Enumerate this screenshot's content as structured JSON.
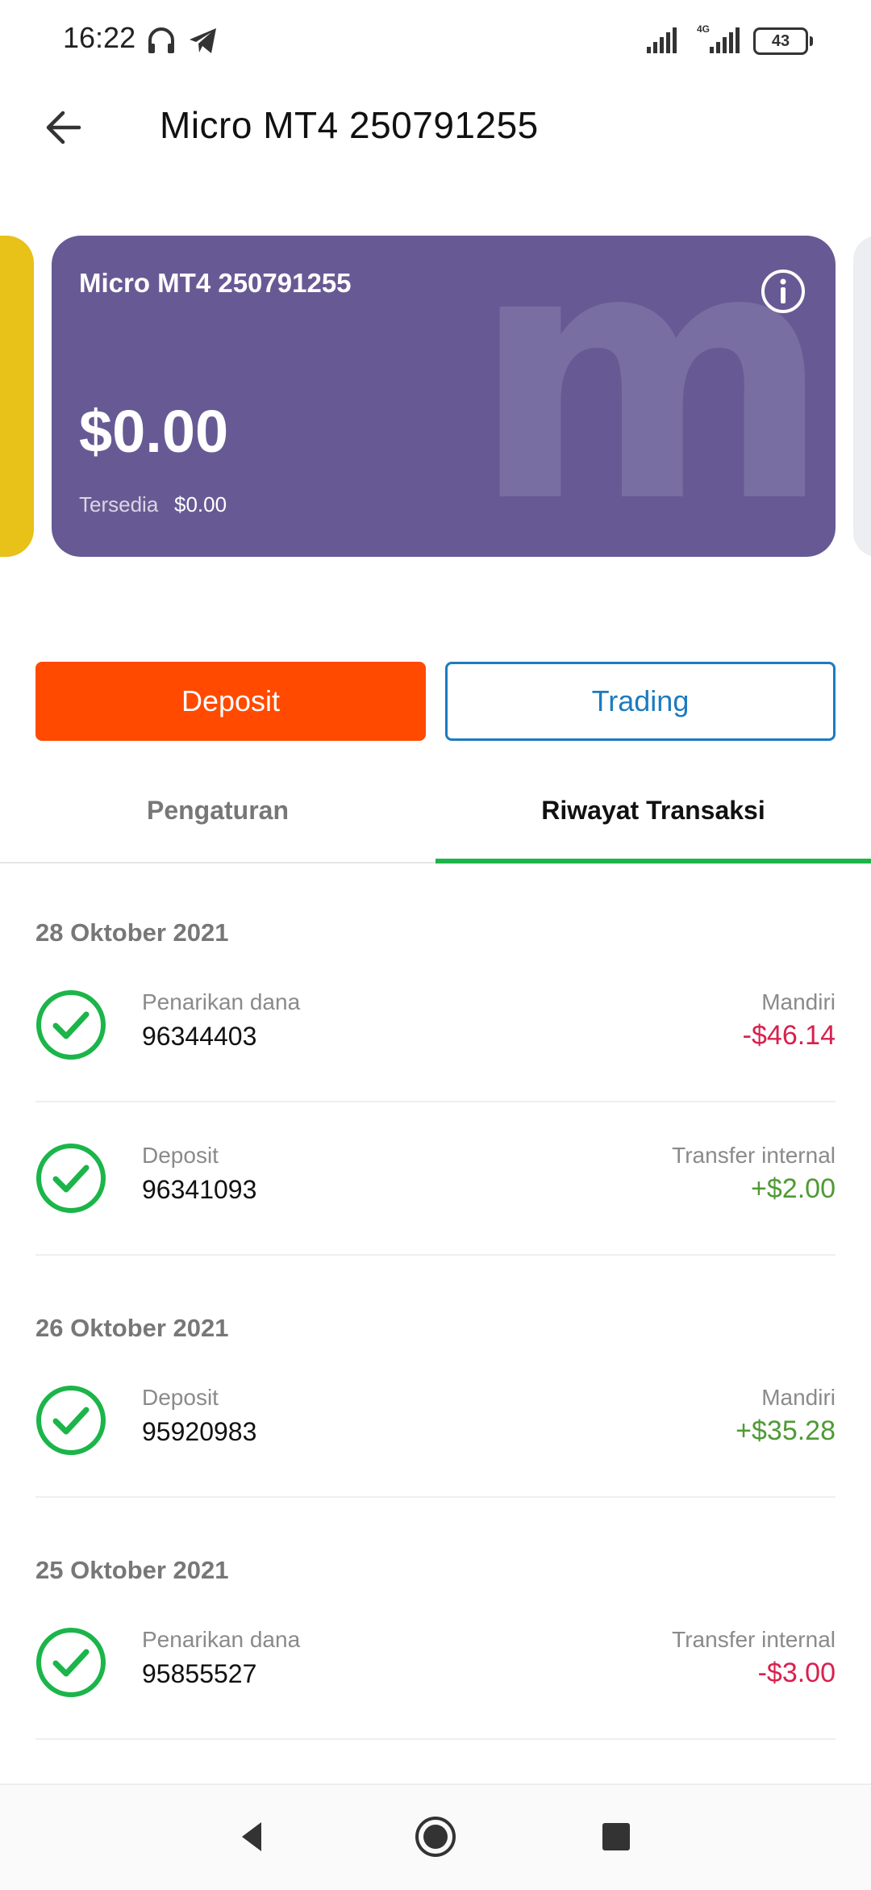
{
  "status_bar": {
    "time": "16:22",
    "battery": "43",
    "icons": [
      "headphones-icon",
      "telegram-icon",
      "signal-icon",
      "4g-signal-icon",
      "battery-icon"
    ]
  },
  "header": {
    "title": "Micro MT4 250791255",
    "back_icon": "arrow-left-icon"
  },
  "account_card": {
    "name": "Micro MT4 250791255",
    "balance": "$0.00",
    "available_label": "Tersedia",
    "available_value": "$0.00",
    "watermark": "m",
    "color": "#675a94"
  },
  "actions": {
    "deposit_label": "Deposit",
    "trading_label": "Trading"
  },
  "tabs": {
    "settings": "Pengaturan",
    "history": "Riwayat Transaksi",
    "active": "history"
  },
  "transactions": {
    "groups": [
      {
        "date": "28 Oktober 2021",
        "items": [
          {
            "type": "Penarikan dana",
            "id": "96344403",
            "method": "Mandiri",
            "amount": "-$46.14",
            "sign": "negative"
          },
          {
            "type": "Deposit",
            "id": "96341093",
            "method": "Transfer internal",
            "amount": "+$2.00",
            "sign": "positive"
          }
        ]
      },
      {
        "date": "26 Oktober 2021",
        "items": [
          {
            "type": "Deposit",
            "id": "95920983",
            "method": "Mandiri",
            "amount": "+$35.28",
            "sign": "positive"
          }
        ]
      },
      {
        "date": "25 Oktober 2021",
        "items": [
          {
            "type": "Penarikan dana",
            "id": "95855527",
            "method": "Transfer internal",
            "amount": "-$3.00",
            "sign": "negative"
          }
        ]
      }
    ]
  },
  "colors": {
    "accent_green": "#1bb549",
    "deposit_orange": "#ff4a00",
    "trading_blue": "#1c7bbf",
    "negative": "#d8214e",
    "positive": "#4f9a35"
  }
}
